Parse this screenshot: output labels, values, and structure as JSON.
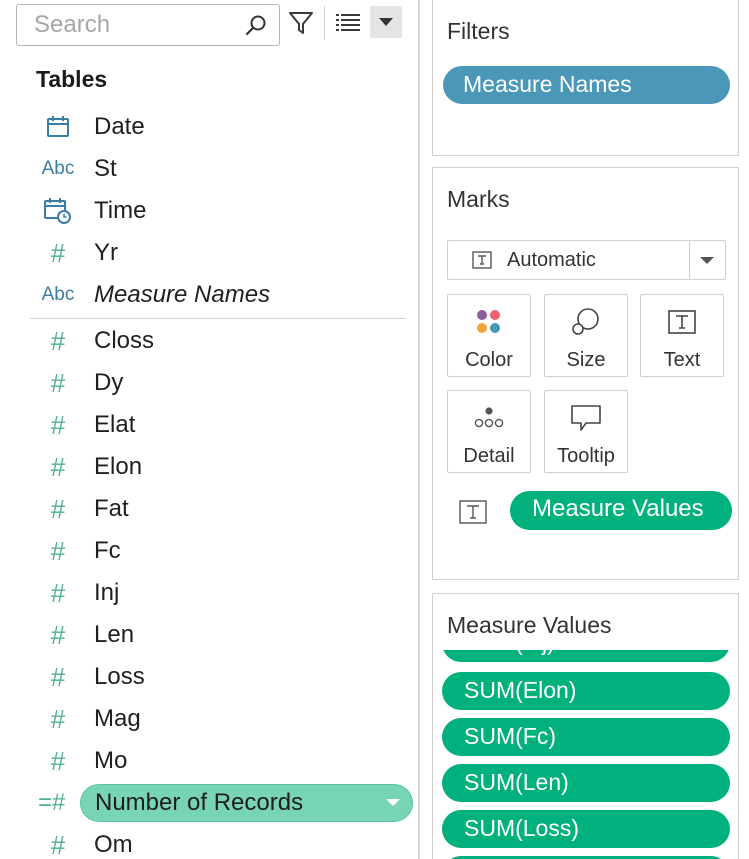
{
  "search": {
    "placeholder": "Search"
  },
  "data_pane": {
    "section_title": "Tables",
    "dimensions": [
      {
        "label": "Date",
        "icon": "calendar-icon"
      },
      {
        "label": "St",
        "icon": "abc-string-icon"
      },
      {
        "label": "Time",
        "icon": "datetime-icon"
      },
      {
        "label": "Yr",
        "icon": "number-icon"
      },
      {
        "label": "Measure Names",
        "icon": "abc-string-icon"
      }
    ],
    "measures": [
      {
        "label": "Closs",
        "icon": "number-icon"
      },
      {
        "label": "Dy",
        "icon": "number-icon"
      },
      {
        "label": "Elat",
        "icon": "number-icon"
      },
      {
        "label": "Elon",
        "icon": "number-icon"
      },
      {
        "label": "Fat",
        "icon": "number-icon"
      },
      {
        "label": "Fc",
        "icon": "number-icon"
      },
      {
        "label": "Inj",
        "icon": "number-icon"
      },
      {
        "label": "Len",
        "icon": "number-icon"
      },
      {
        "label": "Loss",
        "icon": "number-icon"
      },
      {
        "label": "Mag",
        "icon": "number-icon"
      },
      {
        "label": "Mo",
        "icon": "number-icon"
      },
      {
        "label": "Number of Records",
        "icon": "calculated-number-icon",
        "selected": true
      },
      {
        "label": "Om",
        "icon": "number-icon"
      }
    ],
    "icon_text": {
      "abc": "Abc",
      "num": "#",
      "calc": "=#"
    }
  },
  "filters": {
    "title": "Filters",
    "pills": [
      "Measure Names"
    ]
  },
  "marks": {
    "title": "Marks",
    "mark_type": "Automatic",
    "buttons": [
      "Color",
      "Size",
      "Text",
      "Detail",
      "Tooltip"
    ],
    "text_pill": "Measure Values"
  },
  "measure_values": {
    "title": "Measure Values",
    "partial_pill": "SUM(Inj)",
    "pills": [
      "SUM(Elon)",
      "SUM(Fc)",
      "SUM(Len)",
      "SUM(Loss)"
    ]
  },
  "colors": {
    "dimension_blue": "#4a97b8",
    "measure_green": "#00b17e",
    "selected_green": "#78d5b4",
    "icon_green": "#4fb28e",
    "icon_blue": "#3a7fa3"
  }
}
